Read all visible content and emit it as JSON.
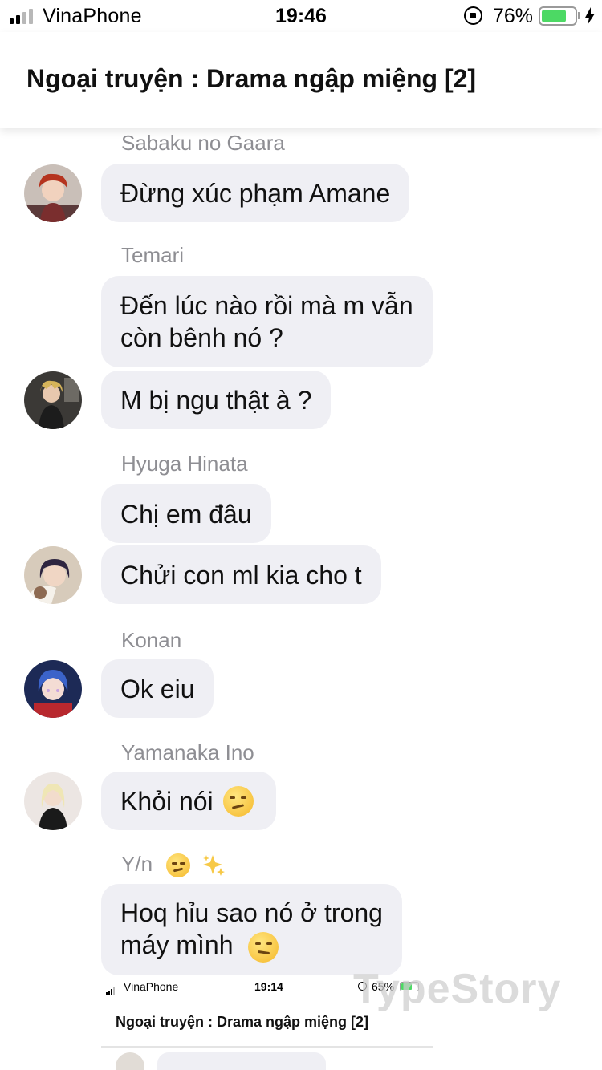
{
  "status_bar": {
    "carrier": "VinaPhone",
    "time": "19:46",
    "battery_percent": "76%",
    "battery_level": 0.76,
    "icons": [
      "signal-icon",
      "orientation-lock-icon",
      "battery-icon",
      "charging-bolt-icon"
    ]
  },
  "header": {
    "title": "Ngoại truyện : Drama ngập miệng [2]"
  },
  "messages": [
    {
      "sender": "Sabaku no Gaara",
      "bubbles": [
        {
          "text": "Đừng xúc phạm Amane"
        }
      ]
    },
    {
      "sender": "Temari",
      "bubbles": [
        {
          "lines": [
            "Đến lúc nào rồi mà m vẫn",
            "còn bênh nó ?"
          ]
        },
        {
          "text": "M bị ngu thật à ?"
        }
      ]
    },
    {
      "sender": "Hyuga Hinata",
      "bubbles": [
        {
          "text": "Chị em đâu"
        },
        {
          "text": "Chửi con ml kia cho t"
        }
      ]
    },
    {
      "sender": "Konan",
      "bubbles": [
        {
          "text": "Ok eiu"
        }
      ]
    },
    {
      "sender": "Yamanaka Ino",
      "bubbles": [
        {
          "text": "Khỏi nói",
          "emoji": "smirking-face"
        }
      ]
    },
    {
      "sender": "Y/n",
      "sender_emoji": [
        "smirking-face",
        "sparkles"
      ],
      "bubbles": [
        {
          "lines": [
            "Hoq hỉu sao nó ở trong",
            "máy mình"
          ],
          "emoji": "confused-face"
        }
      ]
    }
  ],
  "preview": {
    "carrier": "VinaPhone",
    "time": "19:14",
    "battery_percent": "65%",
    "title": "Ngoại truyện : Drama ngập miệng [2]"
  },
  "watermark": "TypeStory",
  "colors": {
    "bubble": "#efeff4",
    "sender_name": "#8e8e93",
    "battery_green": "#4cd964"
  }
}
